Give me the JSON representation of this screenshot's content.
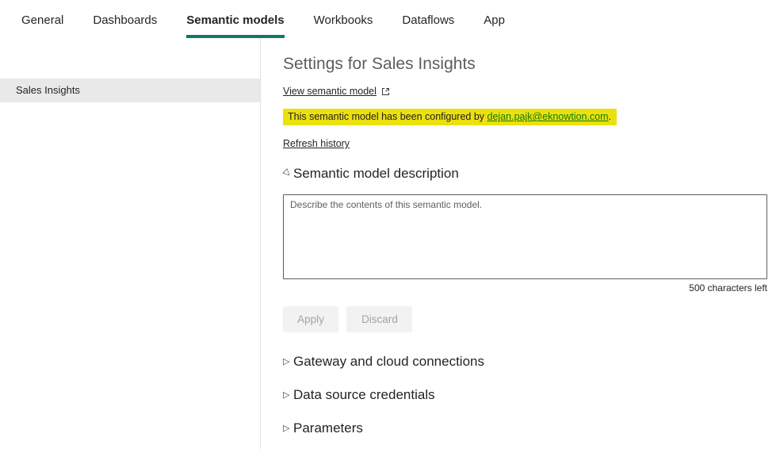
{
  "tabs": {
    "items": [
      {
        "label": "General",
        "active": false
      },
      {
        "label": "Dashboards",
        "active": false
      },
      {
        "label": "Semantic models",
        "active": true
      },
      {
        "label": "Workbooks",
        "active": false
      },
      {
        "label": "Dataflows",
        "active": false
      },
      {
        "label": "App",
        "active": false
      }
    ]
  },
  "sidebar": {
    "items": [
      {
        "label": "Sales Insights",
        "selected": true
      }
    ]
  },
  "main": {
    "title": "Settings for Sales Insights",
    "view_link_label": "View semantic model",
    "configured_note": {
      "prefix": "This semantic model has been configured by ",
      "email": "dejan.pajk@eknowtion.com",
      "suffix": "."
    },
    "refresh_link_label": "Refresh history",
    "description_section": {
      "title": "Semantic model description",
      "placeholder": "Describe the contents of this semantic model.",
      "chars_left": "500 characters left",
      "apply_label": "Apply",
      "discard_label": "Discard"
    },
    "collapsed_sections": [
      {
        "title": "Gateway and cloud connections"
      },
      {
        "title": "Data source credentials"
      },
      {
        "title": "Parameters"
      }
    ]
  },
  "icons": {
    "external_link": "external-link-icon",
    "expanded": "triangle-expanded-icon",
    "collapsed": "triangle-collapsed-icon"
  },
  "colors": {
    "accent": "#117865",
    "highlight": "#ECE00F",
    "email_link": "#107C10"
  }
}
